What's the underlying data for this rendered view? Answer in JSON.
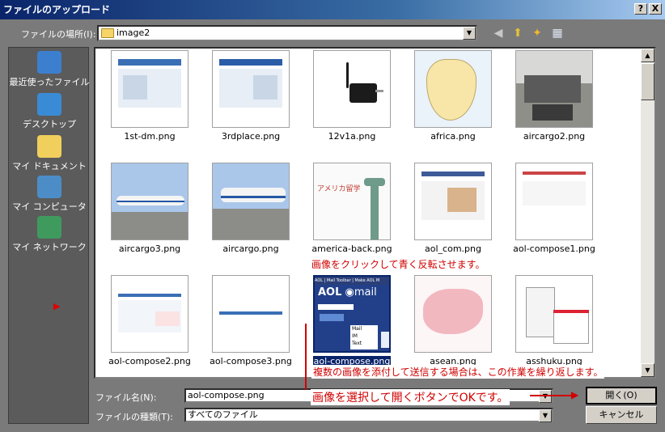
{
  "window": {
    "title": "ファイルのアップロード",
    "help_btn": "?",
    "close_btn": "X"
  },
  "lookin": {
    "label": "ファイルの場所(I):",
    "value": "image2"
  },
  "places": [
    {
      "label": "最近使ったファイル",
      "icon": "recent-icon"
    },
    {
      "label": "デスクトップ",
      "icon": "desktop-icon"
    },
    {
      "label": "マイ ドキュメント",
      "icon": "my-documents-icon"
    },
    {
      "label": "マイ コンピュータ",
      "icon": "my-computer-icon"
    },
    {
      "label": "マイ ネットワーク",
      "icon": "my-network-icon"
    }
  ],
  "places_marker": "▶",
  "files": [
    {
      "name": "1st-dm.png",
      "kind": "doc"
    },
    {
      "name": "3rdplace.png",
      "kind": "doc"
    },
    {
      "name": "12v1a.png",
      "kind": "adapter"
    },
    {
      "name": "africa.png",
      "kind": "map"
    },
    {
      "name": "aircargo2.png",
      "kind": "cargo"
    },
    {
      "name": "aircargo3.png",
      "kind": "plane"
    },
    {
      "name": "aircargo.png",
      "kind": "plane"
    },
    {
      "name": "america-back.png",
      "kind": "liberty"
    },
    {
      "name": "aol_com.png",
      "kind": "doc"
    },
    {
      "name": "aol-compose1.png",
      "kind": "doc"
    },
    {
      "name": "aol-compose2.png",
      "kind": "doc"
    },
    {
      "name": "aol-compose3.png",
      "kind": "doc"
    },
    {
      "name": "aol-compose.png",
      "kind": "aol",
      "selected": true
    },
    {
      "name": "asean.png",
      "kind": "pinkmap"
    },
    {
      "name": "asshuku.png",
      "kind": "menu"
    }
  ],
  "thumb_text": {
    "america": "アメリカ留学",
    "aol_nav": "AOL | Mail Toolbar | Make AOL M",
    "aol_logo": "AOL",
    "aol_mail": "mail",
    "aol_menu": [
      "Mail",
      "IM",
      "Text"
    ]
  },
  "filename": {
    "label": "ファイル名(N):",
    "value": "aol-compose.png"
  },
  "filetype": {
    "label": "ファイルの種類(T):",
    "value": "すべてのファイル"
  },
  "buttons": {
    "open": "開く(O)",
    "cancel": "キャンセル"
  },
  "annotations": {
    "click_note": "画像をクリックして青く反転させます。",
    "multi_note": "複数の画像を添付して送信する場合は、この作業を繰り返します。",
    "open_note": "画像を選択して開くボタンでOKです。"
  },
  "colors": {
    "selection": "#0a246a",
    "annotation": "#d00000"
  }
}
